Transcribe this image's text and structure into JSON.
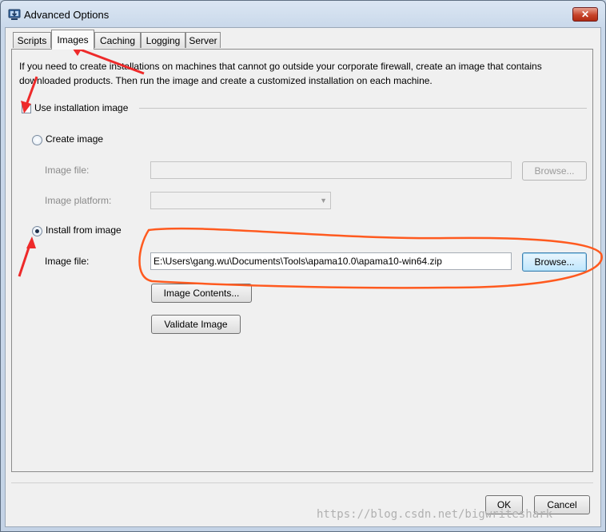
{
  "window": {
    "title": "Advanced Options",
    "close_label": "✕",
    "app_icon": "installer-monitor-icon"
  },
  "tabs": [
    {
      "label": "Scripts"
    },
    {
      "label": "Images",
      "active": true
    },
    {
      "label": "Caching"
    },
    {
      "label": "Logging"
    },
    {
      "label": "Server"
    }
  ],
  "images_tab": {
    "description_line1": "If you need to create installations on machines that cannot go outside your corporate firewall, create an image that contains",
    "description_line2": "downloaded products. Then run the image and create a customized installation on each machine.",
    "use_image": {
      "label": "Use installation image",
      "checked": true
    },
    "create_image": {
      "label": "Create image",
      "selected": false,
      "image_file_label": "Image file:",
      "image_file_value": "",
      "browse_label": "Browse...",
      "platform_label": "Image platform:",
      "platform_value": ""
    },
    "install_from_image": {
      "label": "Install from image",
      "selected": true,
      "image_file_label": "Image file:",
      "image_file_value": "E:\\Users\\gang.wu\\Documents\\Tools\\apama10.0\\apama10-win64.zip",
      "browse_label": "Browse...",
      "image_contents_label": "Image Contents...",
      "validate_label": "Validate Image"
    }
  },
  "footer": {
    "ok_label": "OK",
    "cancel_label": "Cancel"
  },
  "watermark": "https://blog.csdn.net/bigwriteshark",
  "colors": {
    "annotation": "#ff5a1f",
    "arrow": "#ee2a2a",
    "accent": "#3c7fb1"
  }
}
